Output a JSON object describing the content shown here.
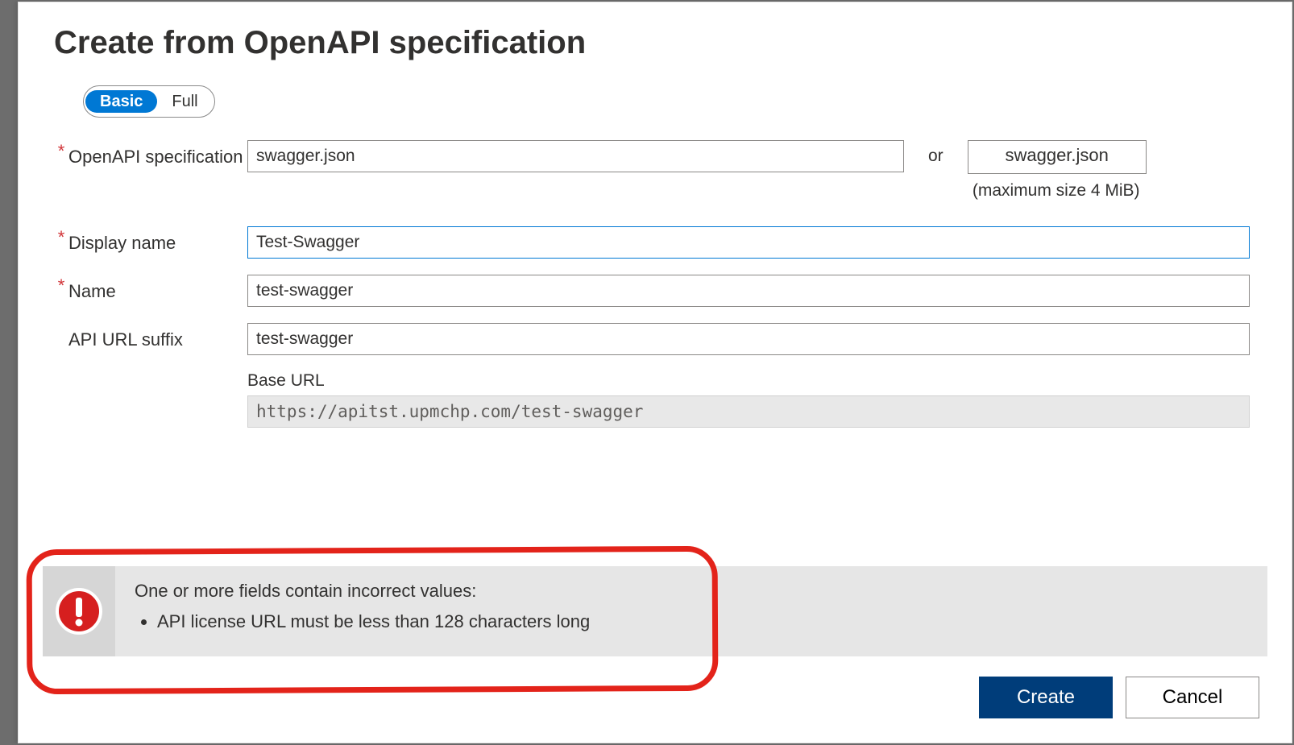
{
  "title": "Create from OpenAPI specification",
  "toggle": {
    "basic": "Basic",
    "full": "Full"
  },
  "fields": {
    "spec_label": "OpenAPI specification",
    "spec_value": "swagger.json",
    "spec_or": "or",
    "file_button": "swagger.json",
    "file_note": "(maximum size 4 MiB)",
    "display_name_label": "Display name",
    "display_name_value": "Test-Swagger",
    "name_label": "Name",
    "name_value": "test-swagger",
    "suffix_label": "API URL suffix",
    "suffix_value": "test-swagger",
    "baseurl_label": "Base URL",
    "baseurl_value": "https://apitst.upmchp.com/test-swagger"
  },
  "error": {
    "heading": "One or more fields contain incorrect values:",
    "item": "API license URL must be less than 128 characters long"
  },
  "buttons": {
    "create": "Create",
    "cancel": "Cancel"
  }
}
